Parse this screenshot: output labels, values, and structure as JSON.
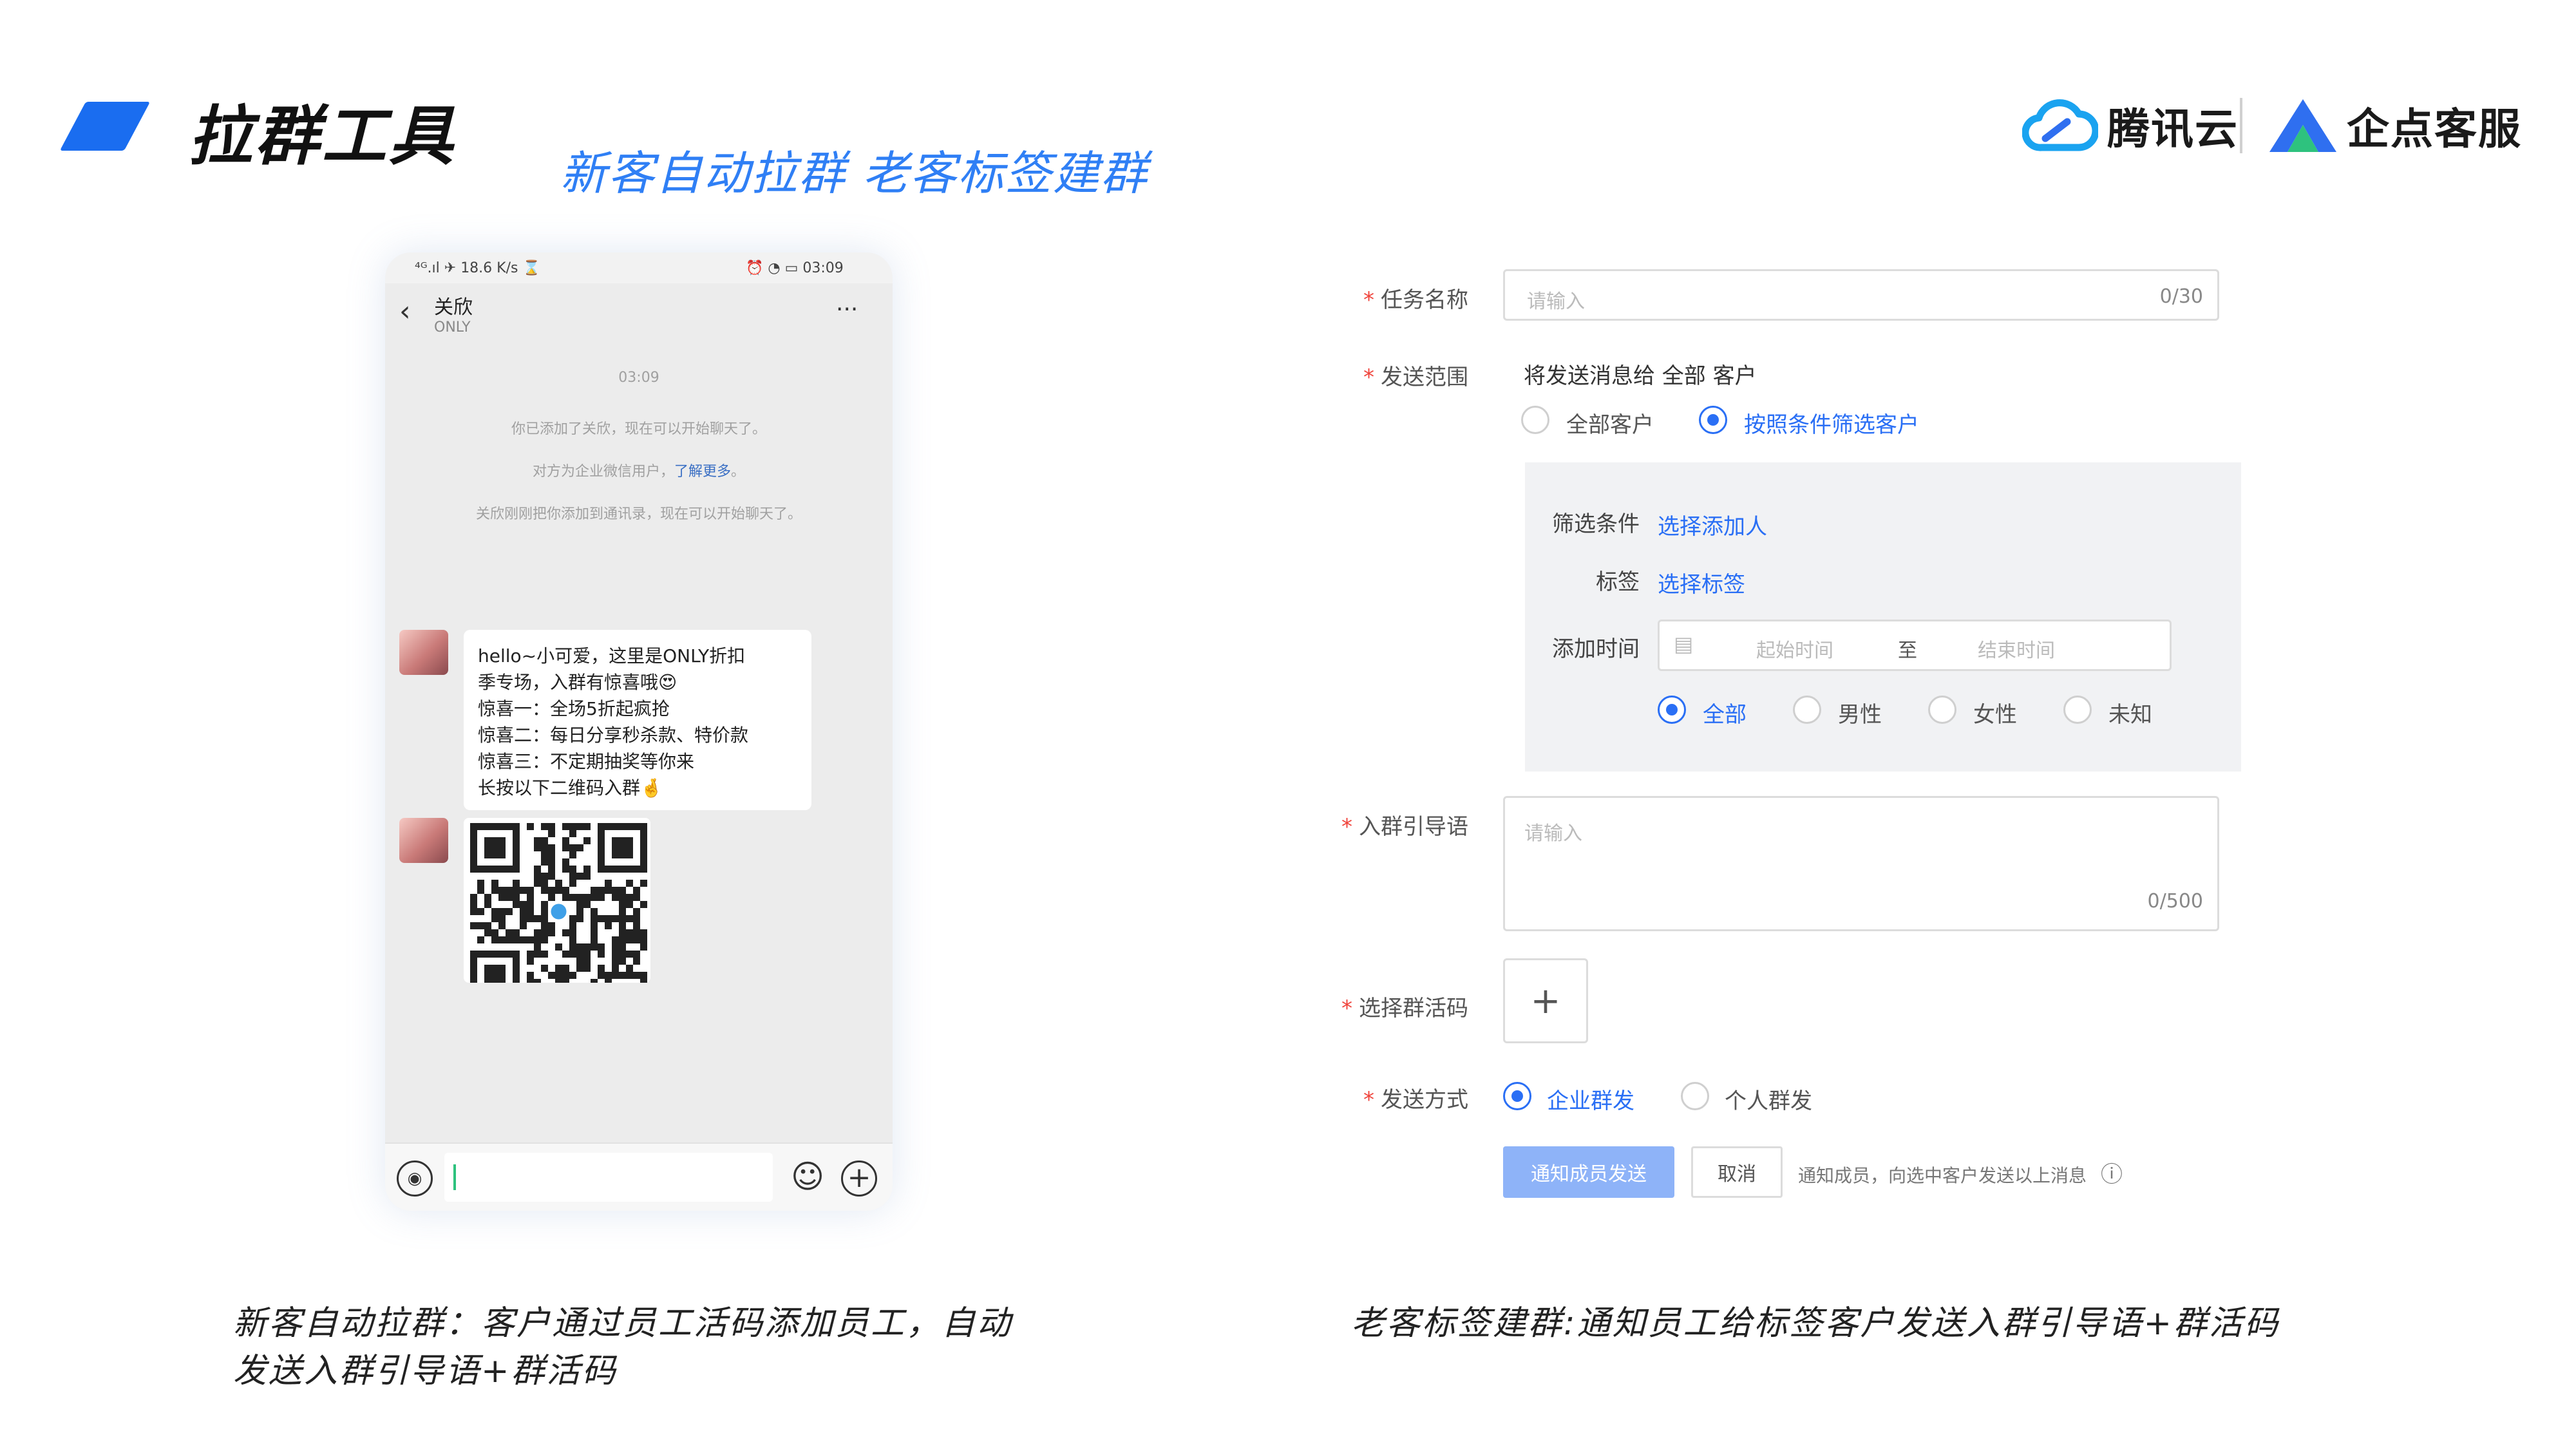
{
  "header": {
    "title": "拉群工具",
    "subtitle": "新客自动拉群  老客标签建群",
    "brand1": "腾讯云",
    "brand2": "企点客服"
  },
  "phone": {
    "status_left": "⁴ᴳ.ıl  ✈ 18.6 K/s  ⌛",
    "status_right": "⏰ ◔ ▭ 03:09",
    "contact_name": "关欣",
    "contact_sub": "ONLY",
    "more": "···",
    "time": "03:09",
    "sys1": "你已添加了关欣，现在可以开始聊天了。",
    "sys2_pre": "对方为企业微信用户，",
    "sys2_link": "了解更多",
    "sys2_post": "。",
    "sys3": "关欣刚刚把你添加到通讯录，现在可以开始聊天了。",
    "message": "hello~小可爱，这里是ONLY折扣\n季专场，入群有惊喜哦😍\n惊喜一：全场5折起疯抢\n惊喜二：每日分享秒杀款、特价款\n惊喜三：不定期抽奖等你来\n长按以下二维码入群🤞"
  },
  "form": {
    "task_name_label": "任务名称",
    "task_name_placeholder": "请输入",
    "task_name_count": "0/30",
    "scope_label": "发送范围",
    "scope_desc": "将发送消息给 全部 客户",
    "scope_opt_all": "全部客户",
    "scope_opt_filter": "按照条件筛选客户",
    "filter_cond_label": "筛选条件",
    "filter_cond_link": "选择添加人",
    "tag_label": "标签",
    "tag_link": "选择标签",
    "time_label": "添加时间",
    "time_start": "起始时间",
    "time_to": "至",
    "time_end": "结束时间",
    "gender_all": "全部",
    "gender_male": "男性",
    "gender_female": "女性",
    "gender_unknown": "未知",
    "guide_label": "入群引导语",
    "guide_placeholder": "请输入",
    "guide_count": "0/500",
    "qrcode_label": "选择群活码",
    "qrcode_add": "+",
    "method_label": "发送方式",
    "method_enterprise": "企业群发",
    "method_personal": "个人群发",
    "submit": "通知成员发送",
    "cancel": "取消",
    "hint": "通知成员，向选中客户发送以上消息",
    "info_icon": "ⓘ"
  },
  "captions": {
    "left_line1": "新客自动拉群：客户通过员工活码添加员工，自动",
    "left_line2": "发送入群引导语+群活码",
    "right": "老客标签建群:通知员工给标签客户发送入群引导语+群活码"
  },
  "colors": {
    "accent": "#1a6df0",
    "link": "#2a6ff5",
    "required": "#f0443c",
    "primary_button": "#8eb3f8"
  }
}
